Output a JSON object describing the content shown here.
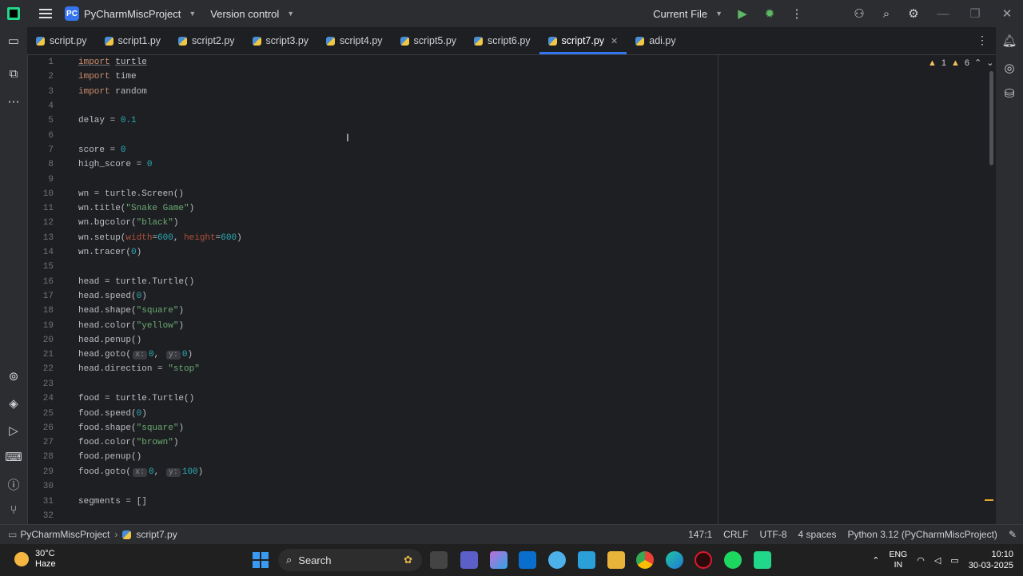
{
  "titlebar": {
    "project_badge": "PC",
    "project_name": "PyCharmMiscProject",
    "vcs": "Version control",
    "run_config": "Current File"
  },
  "tabs": [
    "script.py",
    "script1.py",
    "script2.py",
    "script3.py",
    "script4.py",
    "script5.py",
    "script6.py",
    "script7.py",
    "adi.py"
  ],
  "active_tab": "script7.py",
  "inspections": {
    "warnings": "1",
    "weak_warnings": "6"
  },
  "code": {
    "l1_kw": "import",
    "l1_mod": "turtle",
    "l2_kw": "import",
    "l2_mod": "time",
    "l3_kw": "import",
    "l3_mod": "random",
    "l5_a": "delay = ",
    "l5_n": "0.1",
    "l7_a": "score = ",
    "l7_n": "0",
    "l8_a": "high_score = ",
    "l8_n": "0",
    "l10": "wn = turtle.Screen()",
    "l11_a": "wn.title(",
    "l11_s": "\"Snake Game\"",
    "l11_b": ")",
    "l12_a": "wn.bgcolor(",
    "l12_s": "\"black\"",
    "l12_b": ")",
    "l13_a": "wn.setup(",
    "l13_p1": "width",
    "l13_eq1": "=",
    "l13_n1": "600",
    "l13_c": ", ",
    "l13_p2": "height",
    "l13_eq2": "=",
    "l13_n2": "600",
    "l13_b": ")",
    "l14_a": "wn.tracer(",
    "l14_n": "0",
    "l14_b": ")",
    "l16": "head = turtle.Turtle()",
    "l17_a": "head.speed(",
    "l17_n": "0",
    "l17_b": ")",
    "l18_a": "head.shape(",
    "l18_s": "\"square\"",
    "l18_b": ")",
    "l19_a": "head.color(",
    "l19_s": "\"yellow\"",
    "l19_b": ")",
    "l20": "head.penup()",
    "l21_a": "head.goto(",
    "l21_h1": "x:",
    "l21_n1": "0",
    "l21_c": ", ",
    "l21_h2": "y:",
    "l21_n2": "0",
    "l21_b": ")",
    "l22_a": "head.direction = ",
    "l22_s": "\"stop\"",
    "l24": "food = turtle.Turtle()",
    "l25_a": "food.speed(",
    "l25_n": "0",
    "l25_b": ")",
    "l26_a": "food.shape(",
    "l26_s": "\"square\"",
    "l26_b": ")",
    "l27_a": "food.color(",
    "l27_s": "\"brown\"",
    "l27_b": ")",
    "l28": "food.penup()",
    "l29_a": "food.goto(",
    "l29_h1": "x:",
    "l29_n1": "0",
    "l29_c": ", ",
    "l29_h2": "y:",
    "l29_n2": "100",
    "l29_b": ")",
    "l31": "segments = []"
  },
  "line_numbers": [
    "1",
    "2",
    "3",
    "4",
    "5",
    "6",
    "7",
    "8",
    "9",
    "10",
    "11",
    "12",
    "13",
    "14",
    "15",
    "16",
    "17",
    "18",
    "19",
    "20",
    "21",
    "22",
    "23",
    "24",
    "25",
    "26",
    "27",
    "28",
    "29",
    "30",
    "31",
    "32"
  ],
  "statusbar": {
    "project": "PyCharmMiscProject",
    "file": "script7.py",
    "position": "147:1",
    "line_sep": "CRLF",
    "encoding": "UTF-8",
    "indent": "4 spaces",
    "interpreter": "Python 3.12 (PyCharmMiscProject)"
  },
  "taskbar": {
    "temp": "30°C",
    "weather": "Haze",
    "search": "Search",
    "lang1": "ENG",
    "lang2": "IN",
    "time": "10:10",
    "date": "30-03-2025"
  }
}
